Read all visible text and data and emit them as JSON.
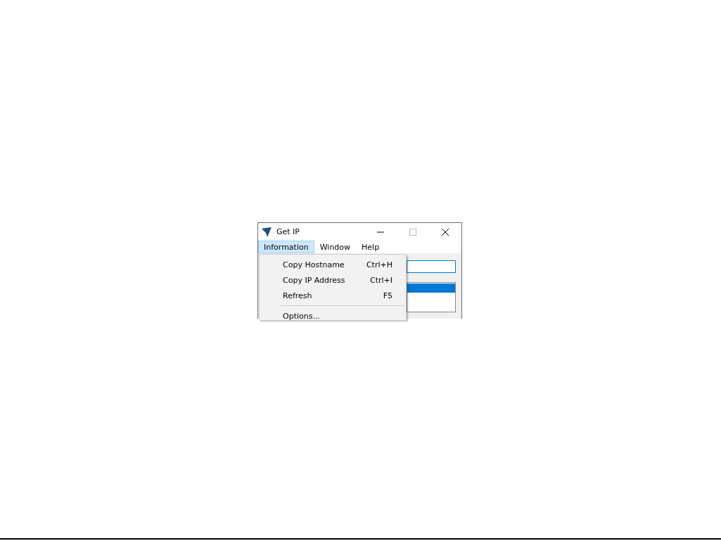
{
  "window": {
    "title": "Get IP"
  },
  "menu": [
    {
      "label": "Information",
      "selected": true
    },
    {
      "label": "Window",
      "selected": false
    },
    {
      "label": "Help",
      "selected": false
    }
  ],
  "dropdown": [
    {
      "kind": "item",
      "label": "Copy Hostname",
      "shortcut": "Ctrl+H"
    },
    {
      "kind": "item",
      "label": "Copy IP Address",
      "shortcut": "Ctrl+I"
    },
    {
      "kind": "item",
      "label": "Refresh",
      "shortcut": "F5"
    },
    {
      "kind": "separator"
    },
    {
      "kind": "item",
      "label": "Options..."
    }
  ],
  "list_rows": [
    {
      "selected": true
    }
  ]
}
